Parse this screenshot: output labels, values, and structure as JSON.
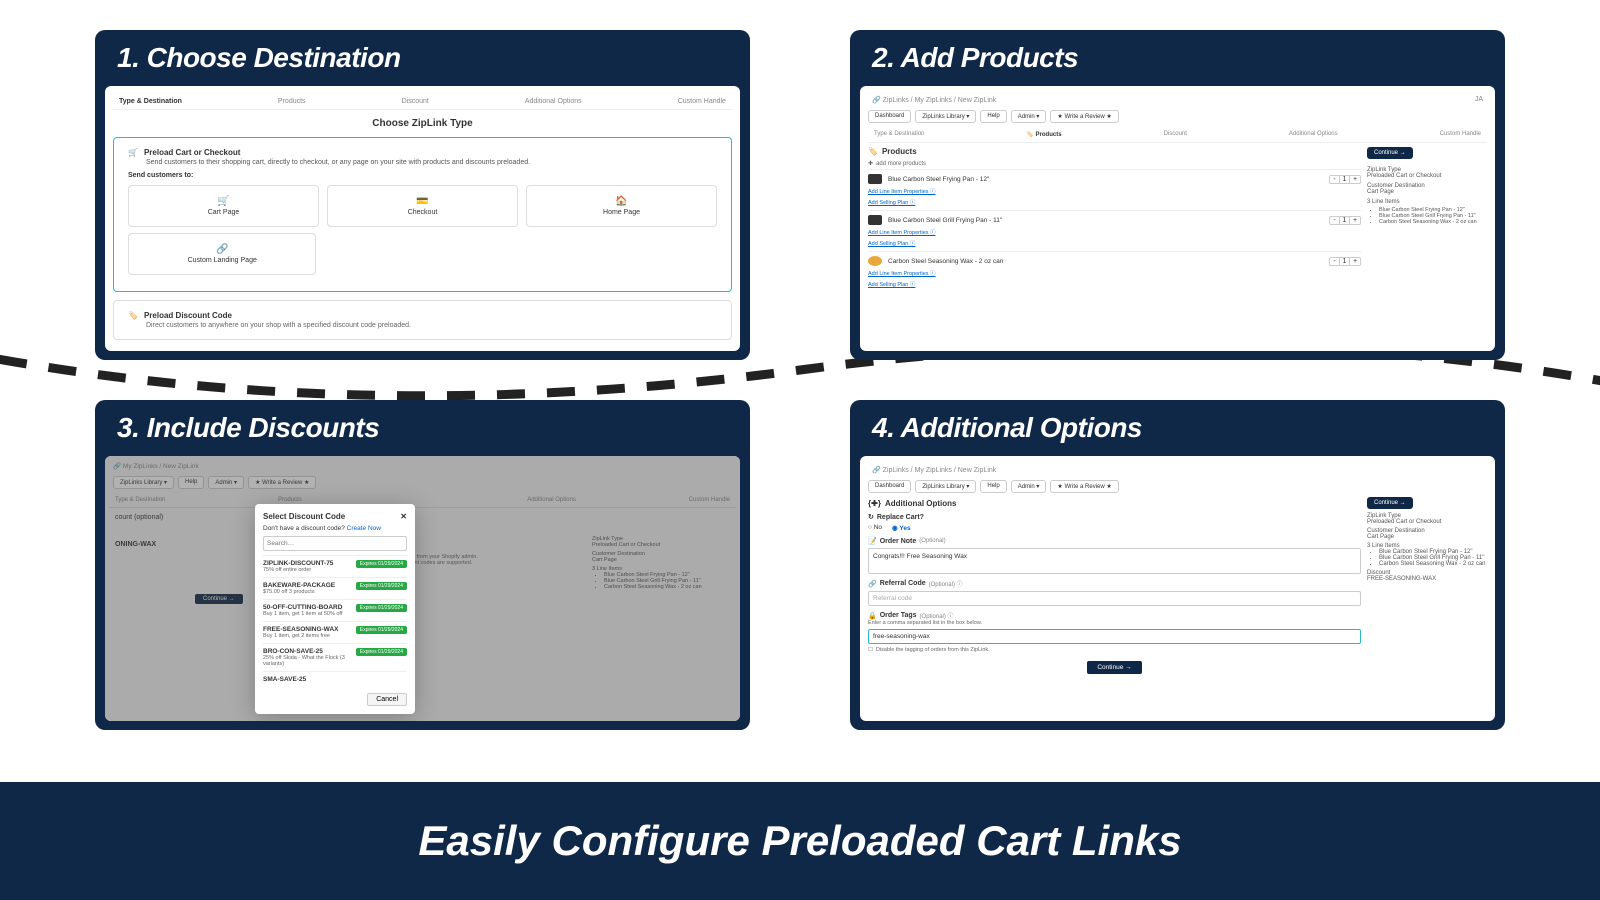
{
  "footer": "Easily Configure Preloaded Cart Links",
  "p1": {
    "title": "1.  Choose Destination",
    "tabs": [
      "Type & Destination",
      "Products",
      "Discount",
      "Additional Options",
      "Custom Handle"
    ],
    "choose": "Choose ZipLink Type",
    "card1": {
      "title": "Preload Cart or Checkout",
      "sub": "Send customers to their shopping cart, directly to checkout, or any page on your site with products and discounts preloaded.",
      "send": "Send customers to:",
      "dest": [
        "Cart Page",
        "Checkout",
        "Home Page",
        "Custom Landing Page"
      ]
    },
    "card2": {
      "title": "Preload Discount Code",
      "sub": "Direct customers to anywhere on your shop with a specified discount code preloaded."
    }
  },
  "p2": {
    "title": "2.  Add Products",
    "crumb": "ZipLinks / My ZipLinks / New ZipLink",
    "avatar": "JA",
    "toolbar": [
      "Dashboard",
      "ZipLinks Library ▾",
      "Help",
      "Admin ▾",
      "★ Write a Review ★"
    ],
    "tabs": [
      "Type & Destination",
      "Products",
      "Discount",
      "Additional Options",
      "Custom Handle"
    ],
    "header": "Products",
    "add": "add more products",
    "continue": "Continue →",
    "products": [
      {
        "name": "Blue Carbon Steel Frying Pan - 12\""
      },
      {
        "name": "Blue Carbon Steel Grill Frying Pan - 11\""
      },
      {
        "name": "Carbon Steel Seasoning Wax - 2 oz can"
      }
    ],
    "link1": "Add Line Item Properties ⓘ",
    "link2": "Add Selling Plan ⓘ",
    "side": {
      "l1": "ZipLink Type",
      "v1": "Preloaded Cart or Checkout",
      "l2": "Customer Destination",
      "v2": "Cart Page",
      "l3": "3 Line Items",
      "items": [
        "Blue Carbon Steel Frying Pan - 12\"",
        "Blue Carbon Steel Grill Frying Pan - 11\"",
        "Carbon Steel Seasoning Wax - 2 oz can"
      ]
    }
  },
  "p3": {
    "title": "3.  Include Discounts",
    "crumb": "My ZipLinks / New ZipLink",
    "toolbar": [
      "ZipLinks Library ▾",
      "Help",
      "Admin ▾",
      "★ Write a Review ★"
    ],
    "modal": {
      "title": "Select Discount Code",
      "sub": "Don't have a discount code?",
      "create": "Create Now",
      "search_ph": "Search…",
      "items": [
        {
          "name": "ZIPLINK-DISCOUNT-75",
          "desc": "75% off entire order",
          "badge": "Expires 01/29/2024"
        },
        {
          "name": "BAKEWARE-PACKAGE",
          "desc": "$75.00 off 3 products",
          "badge": "Expires 01/29/2024"
        },
        {
          "name": "50-OFF-CUTTING-BOARD",
          "desc": "Buy 1 item, get 1 item at 50% off",
          "badge": "Expires 01/29/2024"
        },
        {
          "name": "FREE-SEASONING-WAX",
          "desc": "Buy 1 item, get 2 items free",
          "badge": "Expires 01/29/2024"
        },
        {
          "name": "BRO-CON-SAVE-25",
          "desc": "25% off Skida - What the Flock (3 variants)",
          "badge": "Expires 01/29/2024"
        },
        {
          "name": "SMA-SAVE-25",
          "desc": "",
          "badge": ""
        }
      ],
      "cancel": "Cancel"
    },
    "partial1": "count (optional)",
    "partial2": "ONING-WAX",
    "partial3": "This code will come from your Shopify admin.",
    "partial4": "Automatic discount codes are supported.",
    "partial5": "Continue →",
    "side": {
      "l1": "ZipLink Type",
      "v1": "Preloaded Cart or Checkout",
      "l2": "Customer Destination",
      "v2": "Cart Page",
      "l3": "3 Line Items",
      "items": [
        "Blue Carbon Steel Frying Pan - 12\"",
        "Blue Carbon Steel Grill Frying Pan - 11\"",
        "Carbon Steel Seasoning Wax - 2 oz can"
      ]
    }
  },
  "p4": {
    "title": "4.  Additional Options",
    "crumb": "ZipLinks / My ZipLinks / New ZipLink",
    "toolbar": [
      "Dashboard",
      "ZipLinks Library ▾",
      "Help",
      "Admin ▾",
      "★ Write a Review ★"
    ],
    "header": "Additional Options",
    "continue": "Continue →",
    "replace": {
      "lbl": "Replace Cart?",
      "no": "No",
      "yes": "Yes"
    },
    "note": {
      "lbl": "Order Note",
      "opt": "(Optional)",
      "val": "Congrats!!! Free Seasoning Wax"
    },
    "ref": {
      "lbl": "Referral Code",
      "opt": "(Optional) ⓘ",
      "ph": "Referral code"
    },
    "tags": {
      "lbl": "Order Tags",
      "opt": "(Optional) ⓘ",
      "sub": "Enter a comma separated list in the box below.",
      "val": "free-seasoning-wax",
      "check": "Disable the tagging of orders from this ZipLink."
    },
    "side": {
      "l1": "ZipLink Type",
      "v1": "Preloaded Cart or Checkout",
      "l2": "Customer Destination",
      "v2": "Cart Page",
      "l3": "3 Line Items",
      "items": [
        "Blue Carbon Steel Frying Pan - 12\"",
        "Blue Carbon Steel Grill Frying Pan - 11\"",
        "Carbon Steel Seasoning Wax - 2 oz can"
      ],
      "l4": "Discount",
      "v4": "FREE-SEASONING-WAX"
    }
  }
}
